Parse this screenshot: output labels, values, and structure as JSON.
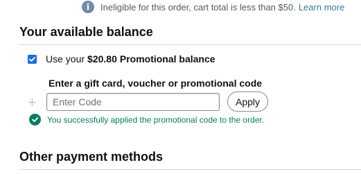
{
  "notice": {
    "icon": "info-icon",
    "icon_glyph": "i",
    "text": "Ineligible for this order, cart total is less than $50.",
    "link": "Learn more"
  },
  "balance_section": {
    "title": "Your available balance",
    "checkbox_checked": true,
    "use_prefix": "Use your",
    "amount": "$20.80",
    "amount_suffix": "Promotional balance"
  },
  "code_section": {
    "heading": "Enter a gift card, voucher or promotional code",
    "plus_glyph": "+",
    "input_placeholder": "Enter Code",
    "input_value": "",
    "apply_label": "Apply",
    "success_message": "You successfully applied the promotional code to the order."
  },
  "other_section": {
    "title": "Other payment methods"
  },
  "colors": {
    "success": "#067d62",
    "link": "#2f7d9b",
    "checkbox": "#1a6ed8"
  }
}
